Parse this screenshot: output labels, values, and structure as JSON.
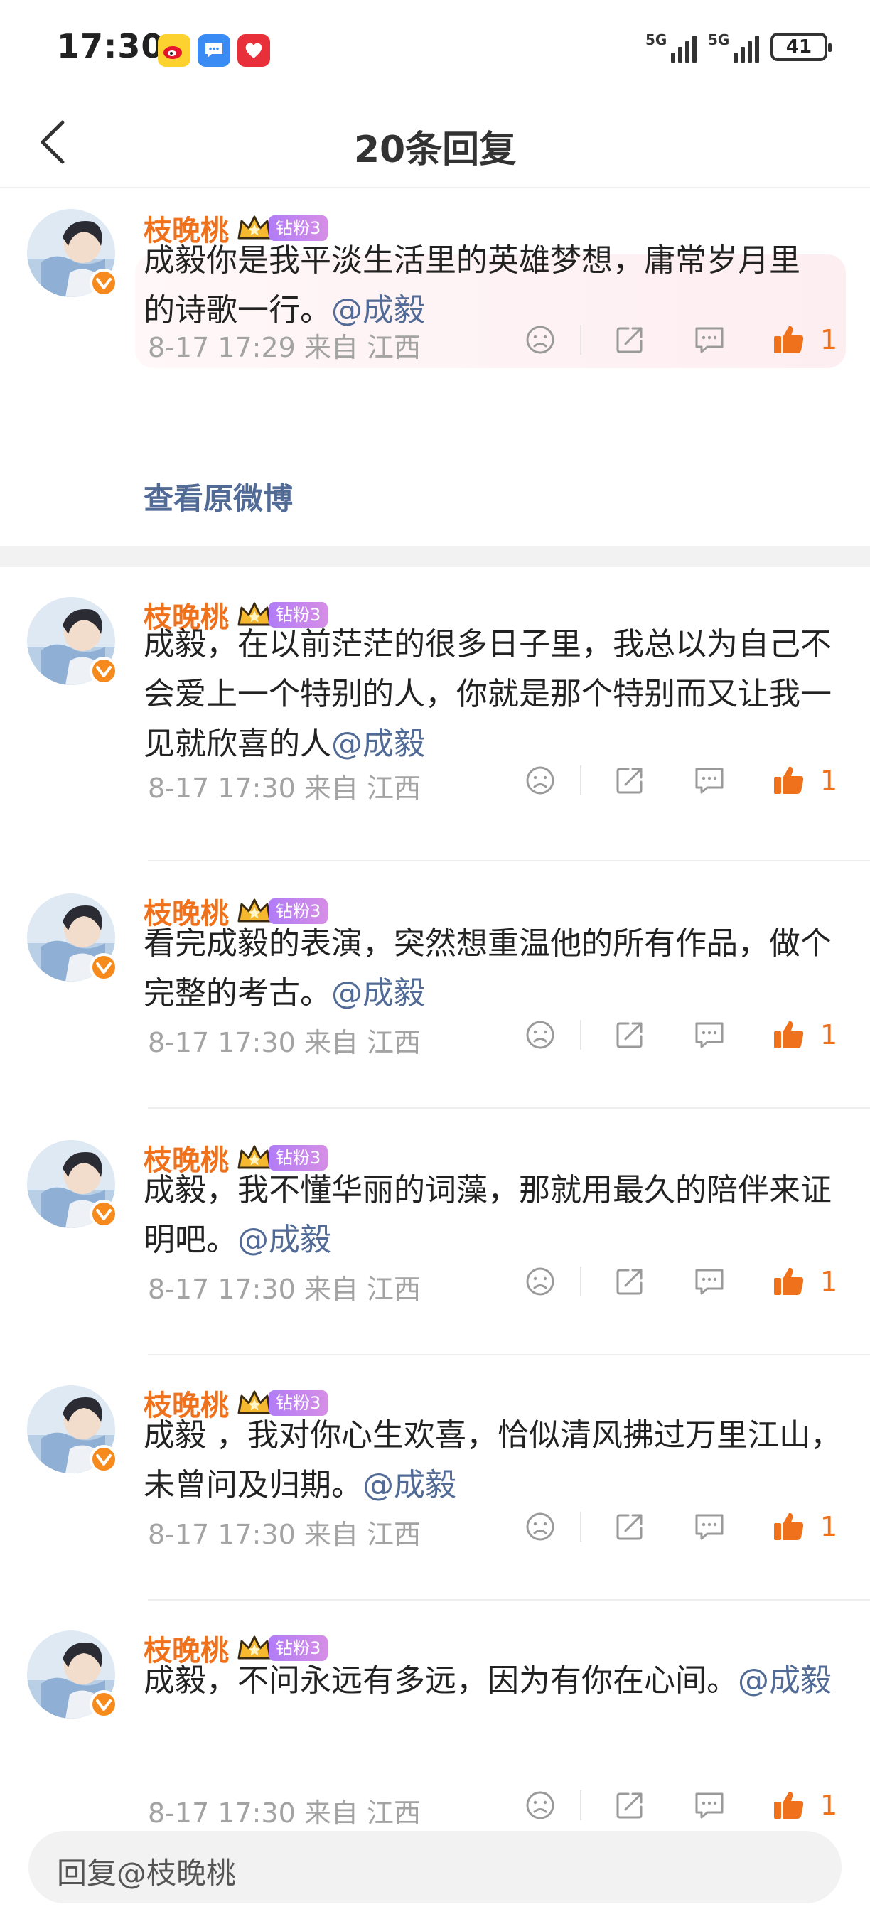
{
  "status_bar": {
    "time": "17:30",
    "app_icons": [
      "weibo-icon",
      "message-icon",
      "health-icon"
    ],
    "signal1_label": "5G",
    "signal2_label": "5G",
    "battery": "41"
  },
  "header": {
    "title": "20条回复"
  },
  "view_original": "查看原微博",
  "comments": [
    {
      "username": "枝晚桃",
      "badge": "钻粉3",
      "text": "成毅你是我平淡生活里的英雄梦想，庸常岁月里的诗歌一行。",
      "mention": "@成毅",
      "meta": "8-17 17:29  来自 江西",
      "likes": "1"
    },
    {
      "username": "枝晚桃",
      "badge": "钻粉3",
      "text": "成毅，在以前茫茫的很多日子里，我总以为自己不会爱上一个特别的人，你就是那个特别而又让我一见就欣喜的人",
      "mention": "@成毅",
      "meta": "8-17 17:30  来自 江西",
      "likes": "1"
    },
    {
      "username": "枝晚桃",
      "badge": "钻粉3",
      "text": "看完成毅的表演，突然想重温他的所有作品，做个完整的考古。",
      "mention": "@成毅",
      "meta": "8-17 17:30  来自 江西",
      "likes": "1"
    },
    {
      "username": "枝晚桃",
      "badge": "钻粉3",
      "text": "成毅，我不懂华丽的词藻，那就用最久的陪伴来证明吧。",
      "mention": "@成毅",
      "meta": "8-17 17:30  来自 江西",
      "likes": "1"
    },
    {
      "username": "枝晚桃",
      "badge": "钻粉3",
      "text": "成毅 ，我对你心生欢喜，恰似清风拂过万里江山，未曾问及归期。",
      "mention": "@成毅",
      "meta": "8-17 17:30  来自 江西",
      "likes": "1"
    },
    {
      "username": "枝晚桃",
      "badge": "钻粉3",
      "text": "成毅，不问永远有多远，因为有你在心间。",
      "mention": "@成毅",
      "meta": "8-17 17:30  来自 江西",
      "likes": "1"
    }
  ],
  "reply_bar": {
    "placeholder": "回复@枝晚桃"
  },
  "colors": {
    "username": "#f0711b",
    "mention": "#526b96",
    "like": "#f0711b",
    "meta": "#a3a3a3"
  }
}
